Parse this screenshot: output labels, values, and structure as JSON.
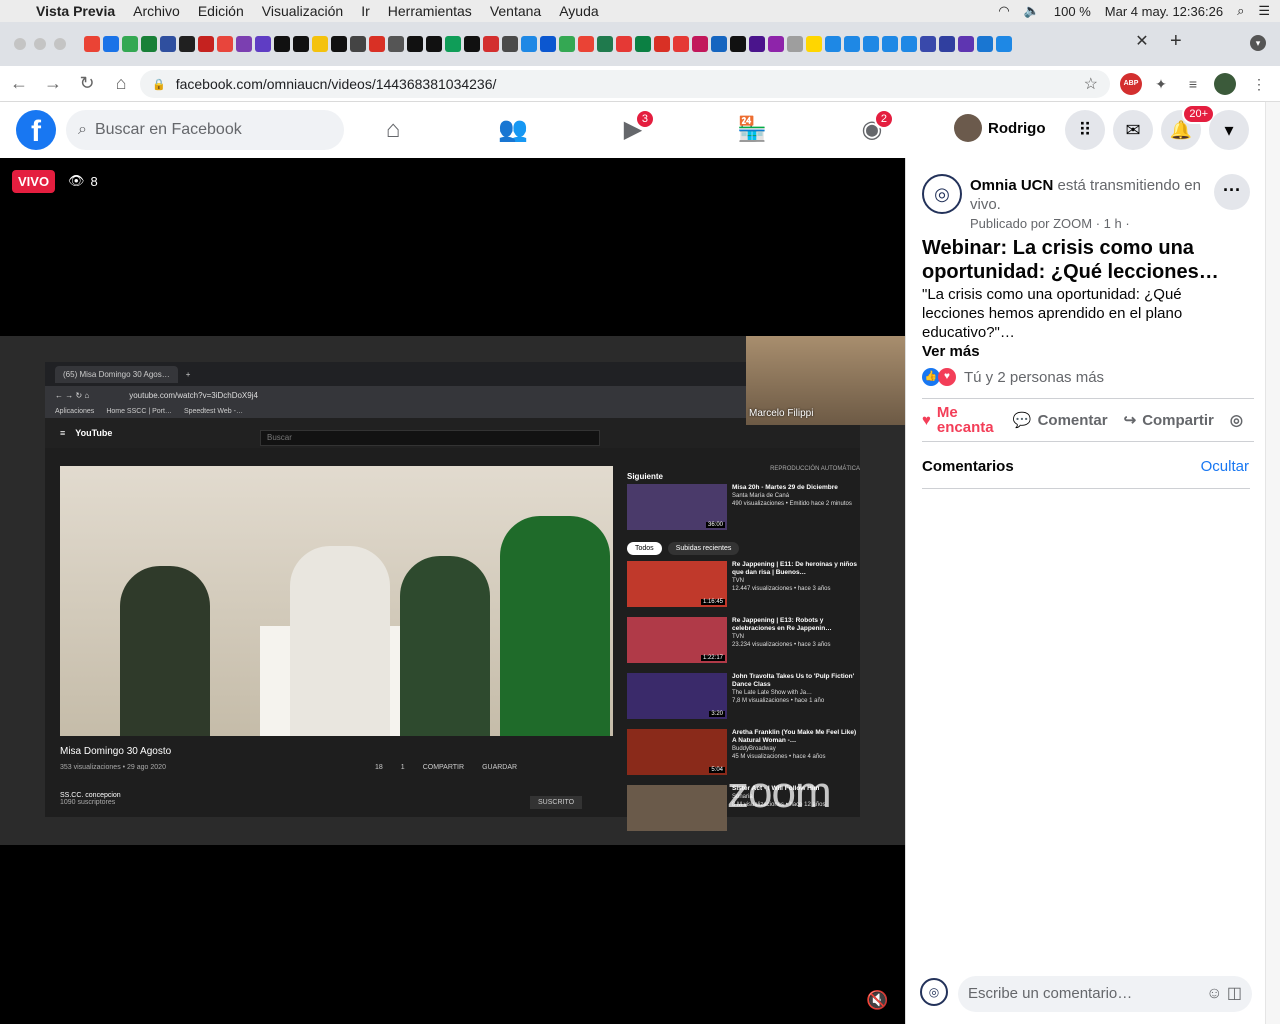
{
  "mac": {
    "apple": "",
    "app": "Vista Previa",
    "menus": [
      "Archivo",
      "Edición",
      "Visualización",
      "Ir",
      "Herramientas",
      "Ventana",
      "Ayuda"
    ],
    "battery": "100 %",
    "datetime": "Mar 4 may.  12:36:26"
  },
  "browser": {
    "url": "facebook.com/omniaucn/videos/144368381034236/",
    "tab_close": "✕",
    "new_tab": "+",
    "ext_abp": "ABP",
    "favicon_colors": [
      "#ea4335",
      "#1a73e8",
      "#34a853",
      "#188038",
      "#2f4f9f",
      "#202020",
      "#c5221f",
      "#e8453c",
      "#7b3fb1",
      "#5f3dc4",
      "#111",
      "#111",
      "#f4c20d",
      "#111",
      "#444",
      "#d93025",
      "#555",
      "#111",
      "#111",
      "#0f9d58",
      "#111",
      "#d32f2f",
      "#4a4a4a",
      "#1e88e5",
      "#0b57d0",
      "#34a853",
      "#ea4335",
      "#1f7a4d",
      "#e53935",
      "#0b8043",
      "#d93025",
      "#e53935",
      "#c2185b",
      "#1565c0",
      "#111",
      "#4a148c",
      "#8e24aa",
      "#9e9e9e",
      "#ffd600",
      "#1e88e5",
      "#1e88e5",
      "#1e88e5",
      "#1e88e5",
      "#1e88e5",
      "#3949ab",
      "#303f9f",
      "#5e35b1",
      "#1976d2",
      "#1e88e5"
    ]
  },
  "facebook": {
    "logo": "f",
    "search_placeholder": "Buscar en Facebook",
    "watch_badge": "3",
    "groups_badge": "2",
    "profile_name": "Rodrigo",
    "notif_badge": "20+"
  },
  "video": {
    "live_label": "VIVO",
    "viewers": "8",
    "cam_name": "Marcelo Filippi",
    "watermark": "zoom",
    "yt": {
      "tab_title": "(65) Misa Domingo 30 Agos…",
      "url": "youtube.com/watch?v=3iDchDoX9j4",
      "bookmarks": [
        "Aplicaciones",
        "Home SSCC | Port…",
        "Speedtest Web -…"
      ],
      "logo": "YouTube",
      "search": "Buscar",
      "title": "Misa Domingo 30 Agosto",
      "meta": "353 visualizaciones • 29 ago 2020",
      "likes": "18",
      "dislikes": "1",
      "share": "COMPARTIR",
      "save": "GUARDAR",
      "channel": "SS.CC. concepcion",
      "subs": "1090 suscriptores",
      "subscribed": "SUSCRITO",
      "next_label": "Siguiente",
      "autoplay": "REPRODUCCIÓN AUTOMÁTICA",
      "chip_all": "Todos",
      "chip_recent": "Subidas recientes",
      "side": [
        {
          "title": "Misa 20h - Martes 29 de Diciembre",
          "ch": "Santa María de Caná",
          "meta": "490 visualizaciones • Emitido hace 2 minutos",
          "dur": "36:00",
          "color": "#4a3a6a"
        },
        {
          "title": "Re Jappening | E11: De heroínas y niños que dan risa | Buenos…",
          "ch": "TVN",
          "meta": "12.447 visualizaciones • hace 3 años",
          "dur": "1:16:45",
          "color": "#c0392b"
        },
        {
          "title": "Re Jappening | E13: Robots y celebraciones en Re Jappenin…",
          "ch": "TVN",
          "meta": "23.234 visualizaciones • hace 3 años",
          "dur": "1:22:17",
          "color": "#b03a48"
        },
        {
          "title": "John Travolta Takes Us to 'Pulp Fiction' Dance Class",
          "ch": "The Late Late Show with Ja…",
          "meta": "7,8 M visualizaciones • hace 1 año",
          "dur": "3:20",
          "color": "#3a2a6a"
        },
        {
          "title": "Aretha Franklin (You Make Me Feel Like) A Natural Woman -…",
          "ch": "BuddyBroadway",
          "meta": "45 M visualizaciones • hace 4 años",
          "dur": "5:04",
          "color": "#8a2a1a"
        },
        {
          "title": "Sister Act - I Will Follow Him",
          "ch": "Sonaria",
          "meta": "8 M visualizaciones • hace 12 años",
          "dur": "",
          "color": "#6a5a4a"
        }
      ]
    }
  },
  "post": {
    "page": "Omnia UCN",
    "status": "está transmitiendo en vivo.",
    "published": "Publicado por ZOOM",
    "time": "· 1 h ·",
    "title": "Webinar: La crisis como una oportunidad: ¿Qué lecciones…",
    "description": "\"La crisis como una oportunidad: ¿Qué lecciones hemos aprendido en el plano educativo?\"…",
    "see_more": "Ver más",
    "reactions": "Tú y 2 personas más",
    "love": "Me encanta",
    "comment": "Comentar",
    "share": "Compartir",
    "comments_title": "Comentarios",
    "hide": "Ocultar",
    "comment_placeholder": "Escribe un comentario…"
  }
}
